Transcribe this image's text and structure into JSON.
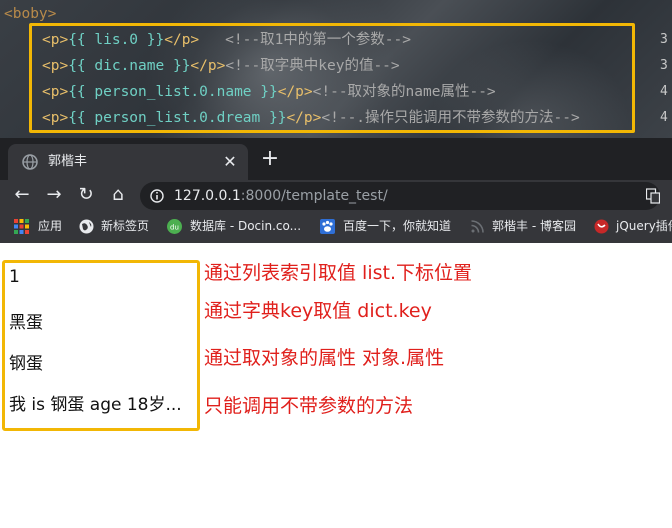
{
  "editor": {
    "prev_line_fragment": "<boby>",
    "lines": [
      {
        "tag_open": "<p>",
        "tpl": "{{ lis.0 }}",
        "tag_close": "</p>",
        "comment": "<!--取1中的第一个参数-->"
      },
      {
        "tag_open": "<p>",
        "tpl": "{{ dic.name }}",
        "tag_close": "</p>",
        "comment": "<!--取字典中key的值-->"
      },
      {
        "tag_open": "<p>",
        "tpl": "{{ person_list.0.name }}",
        "tag_close": "</p>",
        "comment": "<!--取对象的name属性-->"
      },
      {
        "tag_open": "<p>",
        "tpl": "{{ person_list.0.dream }}",
        "tag_close": "</p>",
        "comment": "<!--.操作只能调用不带参数的方法-->"
      }
    ],
    "gutter": [
      "3",
      "3",
      "4",
      "4"
    ],
    "colors": {
      "highlight": "#f2b705",
      "tag": "#e8bf6a",
      "template": "#6fd0c4",
      "comment": "#a9a9a9"
    }
  },
  "browser": {
    "tab_title": "郭楷丰",
    "tab_close": "✕",
    "new_tab": "+",
    "back": "←",
    "forward": "→",
    "reload": "↻",
    "home": "⌂",
    "url_host": "127.0.0.1",
    "url_rest": ":8000/template_test/",
    "translate_icon": "translate-icon",
    "bookmarks": [
      {
        "label": "应用",
        "icon": "apps-grid-icon"
      },
      {
        "label": "新标签页",
        "icon": "globe-icon"
      },
      {
        "label": "数据库 - Docin.co...",
        "icon": "docin-icon"
      },
      {
        "label": "百度一下，你就知道",
        "icon": "baidu-paw-icon"
      },
      {
        "label": "郭楷丰 - 博客园",
        "icon": "cnblogs-icon"
      },
      {
        "label": "jQuery插件",
        "icon": "jquery-icon"
      }
    ]
  },
  "page": {
    "results": [
      "1",
      "黑蛋",
      "钢蛋",
      "我 is 钢蛋 age 18岁..."
    ],
    "notes": [
      "通过列表索引取值 list.下标位置",
      "通过字典key取值 dict.key",
      "通过取对象的属性 对象.属性",
      "只能调用不带参数的方法"
    ],
    "note_color": "#e0201c"
  }
}
